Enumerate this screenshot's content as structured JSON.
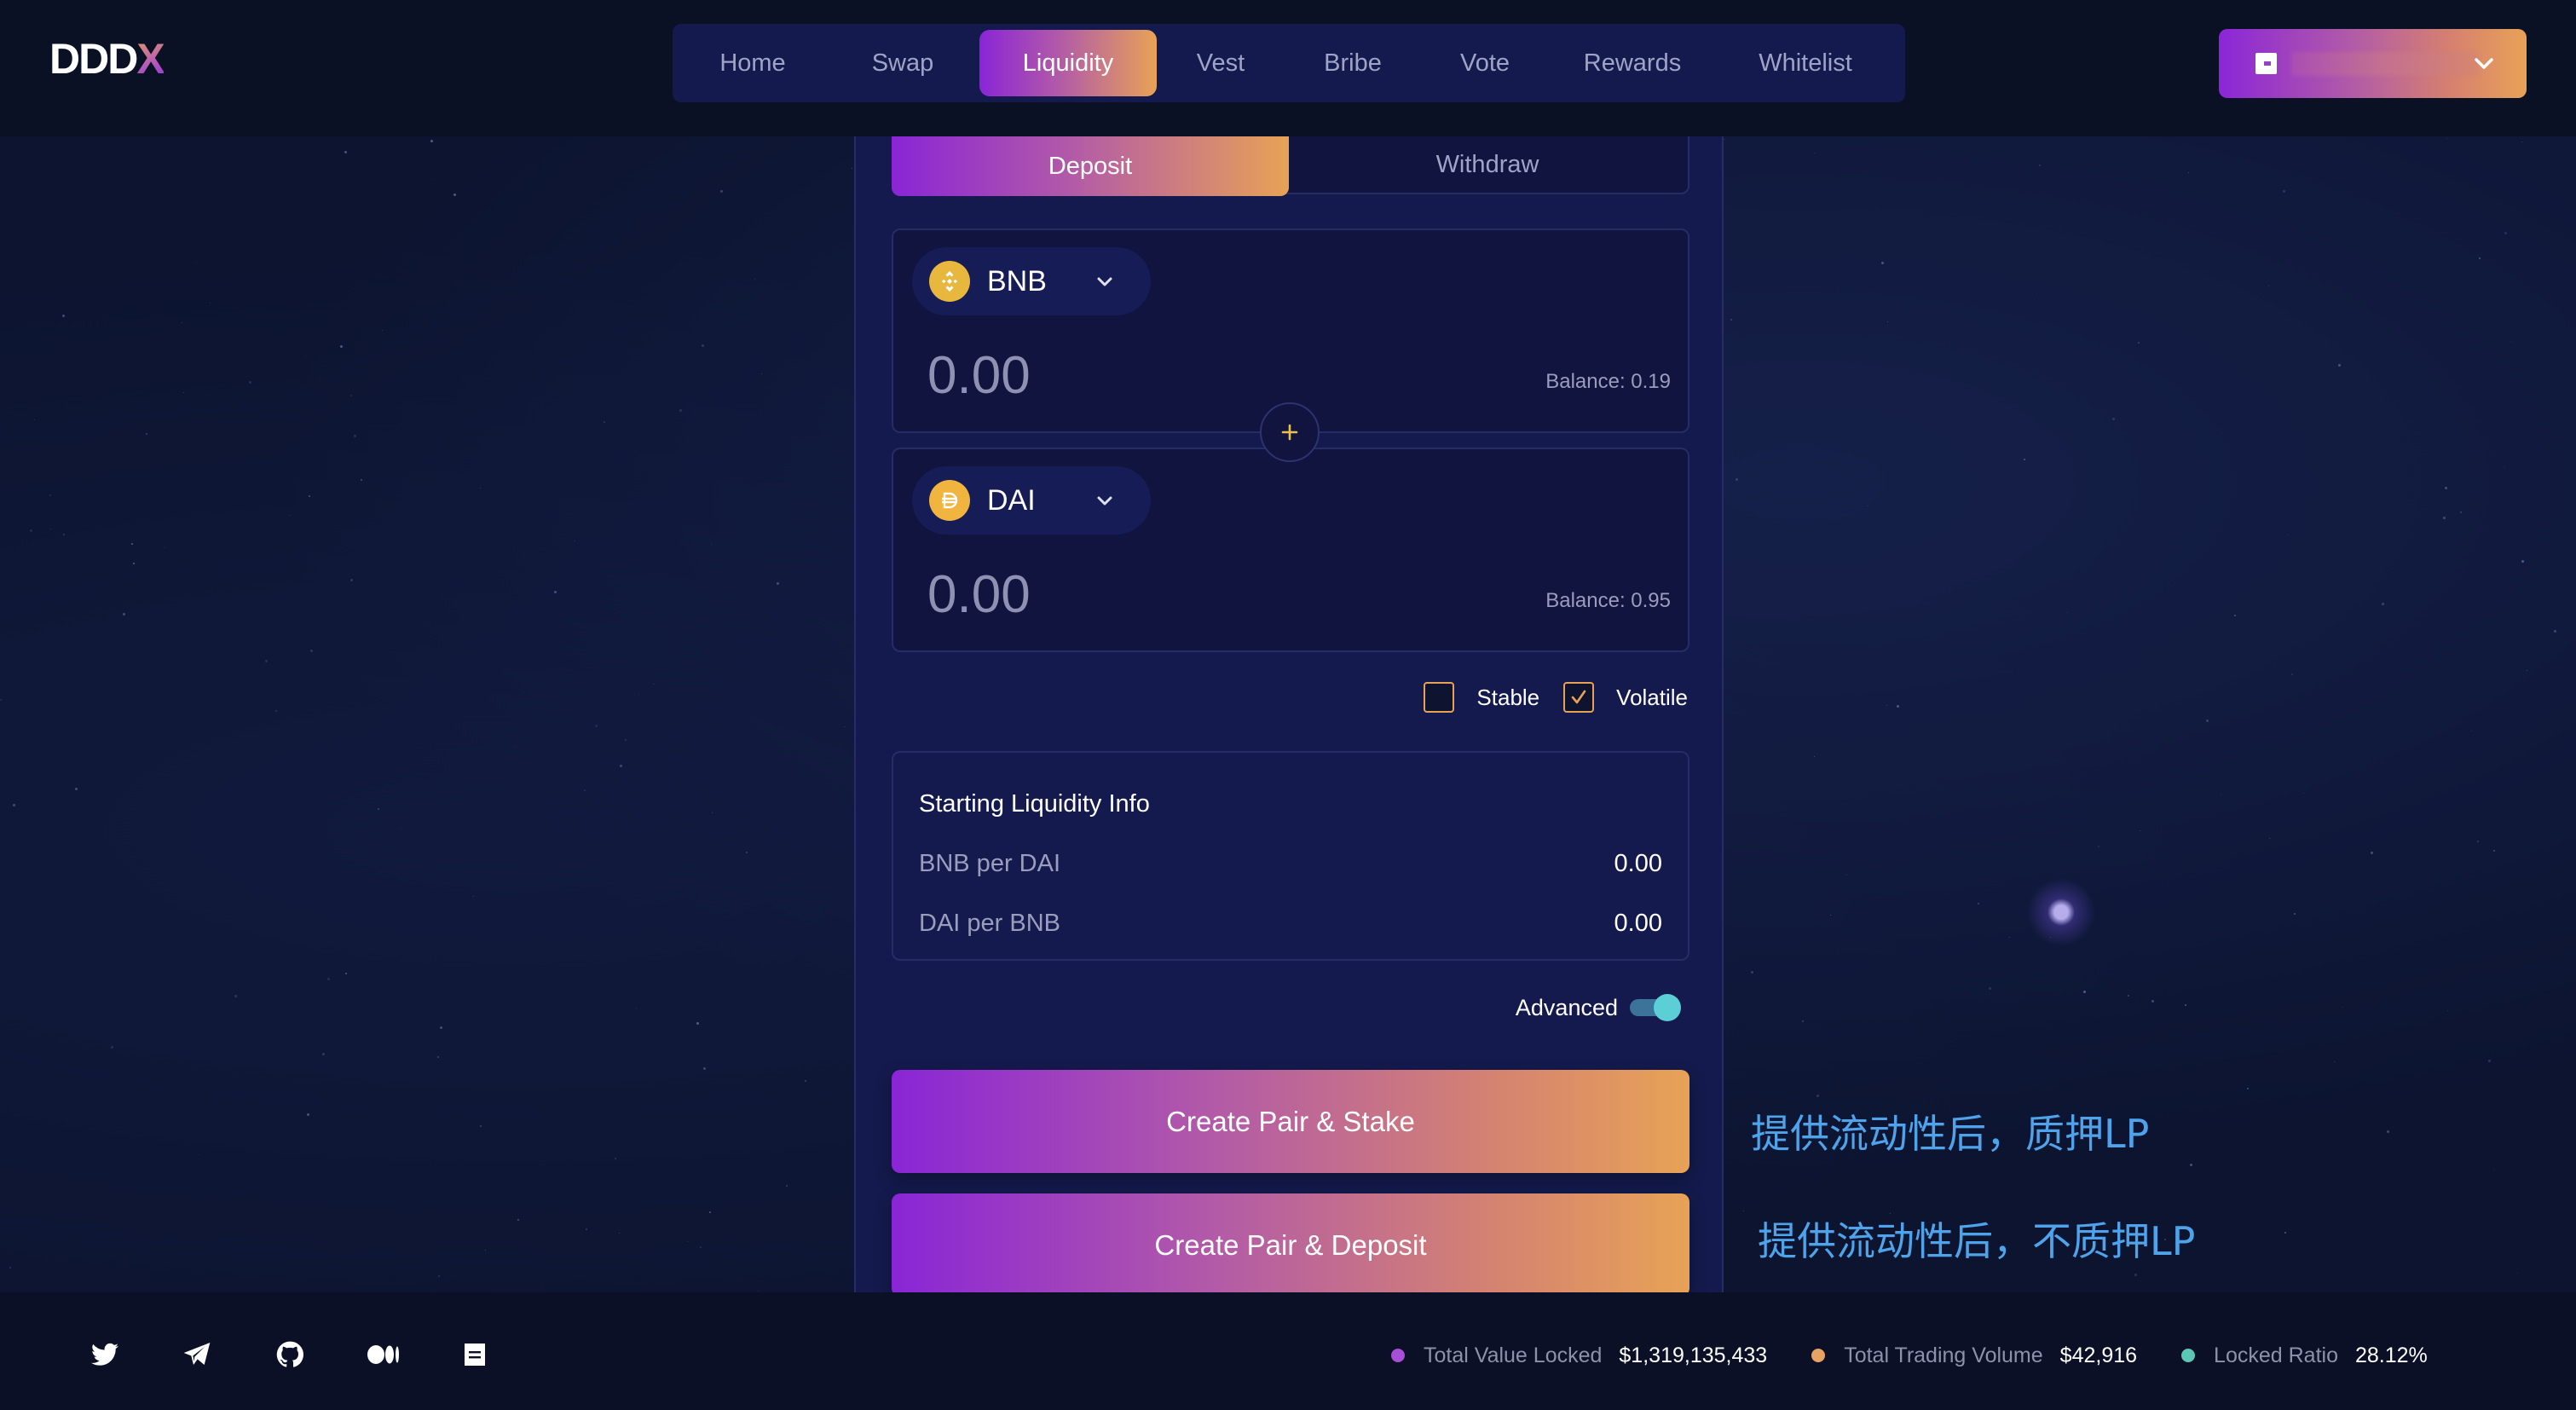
{
  "app": {
    "logo_main": "DDD",
    "logo_accent": "X"
  },
  "nav": {
    "items": [
      {
        "label": "Home",
        "active": false
      },
      {
        "label": "Swap",
        "active": false
      },
      {
        "label": "Liquidity",
        "active": true
      },
      {
        "label": "Vest",
        "active": false
      },
      {
        "label": "Bribe",
        "active": false
      },
      {
        "label": "Vote",
        "active": false
      },
      {
        "label": "Rewards",
        "active": false
      },
      {
        "label": "Whitelist",
        "active": false
      }
    ]
  },
  "wallet": {
    "icon": "wallet-icon",
    "address": "0x12…3456",
    "chevron": "chevron-down-icon"
  },
  "liquidity": {
    "tabs": [
      {
        "label": "Deposit",
        "active": true
      },
      {
        "label": "Withdraw",
        "active": false
      }
    ],
    "token_a": {
      "symbol": "BNB",
      "icon": "bnb-icon",
      "amount_placeholder": "0.00",
      "balance": "Balance: 0.19"
    },
    "token_b": {
      "symbol": "DAI",
      "icon": "dai-icon",
      "amount_placeholder": "0.00",
      "balance": "Balance: 0.95"
    },
    "plus_icon": "plus-icon",
    "pool_type": {
      "stable_label": "Stable",
      "stable_checked": false,
      "volatile_label": "Volatile",
      "volatile_checked": true
    },
    "info": {
      "title": "Starting Liquidity Info",
      "rows": [
        {
          "label": "BNB per DAI",
          "value": "0.00"
        },
        {
          "label": "DAI per BNB",
          "value": "0.00"
        }
      ]
    },
    "advanced": {
      "label": "Advanced",
      "enabled": true
    },
    "actions": {
      "stake_label": "Create Pair & Stake",
      "deposit_label": "Create Pair & Deposit"
    }
  },
  "annotations": {
    "stake_note": "提供流动性后，质押LP",
    "deposit_note": "提供流动性后，不质押LP"
  },
  "footer": {
    "social": [
      {
        "name": "twitter-icon"
      },
      {
        "name": "telegram-icon"
      },
      {
        "name": "github-icon"
      },
      {
        "name": "medium-icon"
      },
      {
        "name": "docs-icon"
      }
    ],
    "stats": [
      {
        "label": "Total Value Locked",
        "value": "$1,319,135,433",
        "color": "#a74fd6"
      },
      {
        "label": "Total Trading Volume",
        "value": "$42,916",
        "color": "#e8a261"
      },
      {
        "label": "Locked Ratio",
        "value": "28.12%",
        "color": "#5cc7b5"
      }
    ]
  },
  "colors": {
    "accent_start": "#8a25d6",
    "accent_end": "#e8a256",
    "panel": "#141a4d",
    "background": "#0b1026",
    "annotation": "#4ea3ea"
  }
}
